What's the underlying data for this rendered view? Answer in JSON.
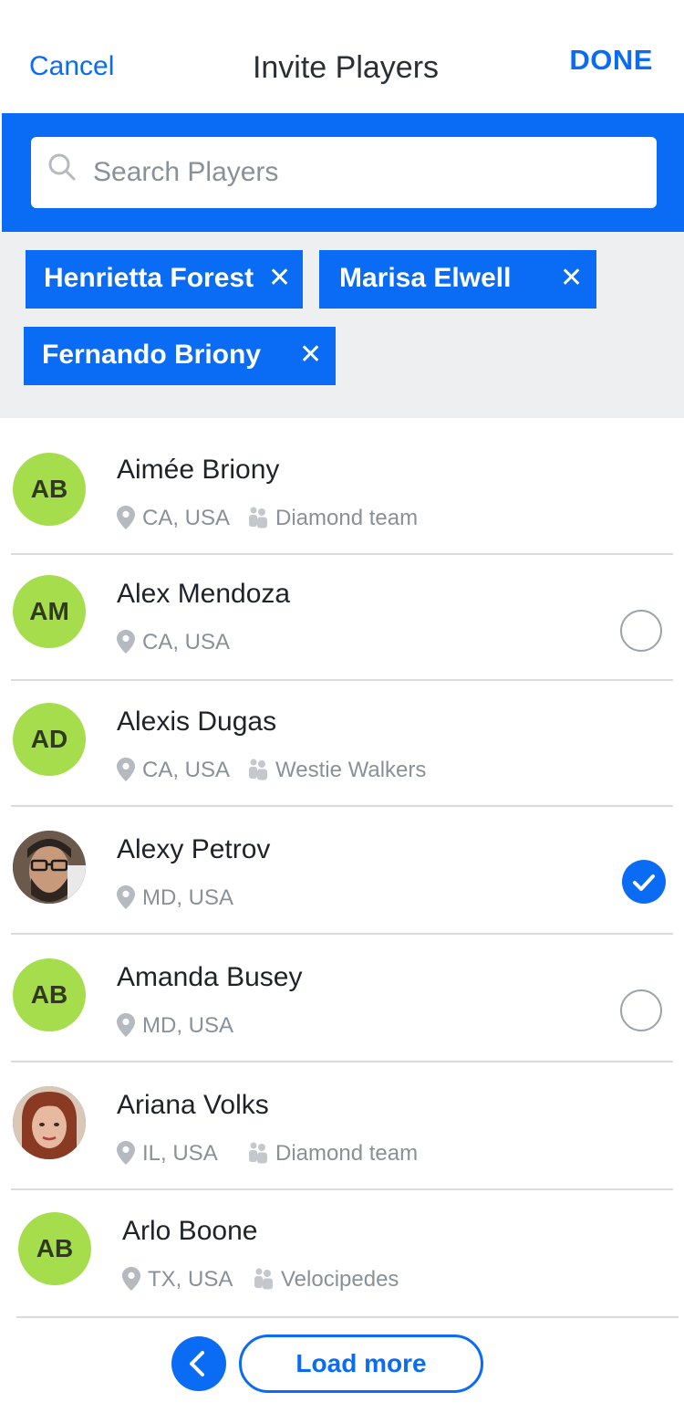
{
  "header": {
    "cancel_label": "Cancel",
    "title": "Invite Players",
    "done_label": "DONE"
  },
  "search": {
    "placeholder": "Search Players",
    "value": ""
  },
  "selected_chips": [
    {
      "label": "Henrietta Forest",
      "remove_glyph": "✕"
    },
    {
      "label": "Marisa Elwell",
      "remove_glyph": "✕"
    },
    {
      "label": "Fernando Briony",
      "remove_glyph": "✕"
    }
  ],
  "players": [
    {
      "initials": "AB",
      "name": "Aimée Briony",
      "location": "CA, USA",
      "team": "Diamond team",
      "avatar_type": "initials",
      "selection": "none"
    },
    {
      "initials": "AM",
      "name": "Alex Mendoza",
      "location": "CA, USA",
      "team": "",
      "avatar_type": "initials",
      "selection": "unchecked"
    },
    {
      "initials": "AD",
      "name": "Alexis Dugas",
      "location": "CA, USA",
      "team": "Westie Walkers",
      "avatar_type": "initials",
      "selection": "none"
    },
    {
      "initials": "",
      "name": "Alexy Petrov",
      "location": "MD, USA",
      "team": "",
      "avatar_type": "photo-man-glasses",
      "selection": "checked"
    },
    {
      "initials": "AB",
      "name": "Amanda Busey",
      "location": "MD, USA",
      "team": "",
      "avatar_type": "initials",
      "selection": "unchecked"
    },
    {
      "initials": "",
      "name": "Ariana Volks",
      "location": "IL, USA",
      "team": "Diamond team",
      "avatar_type": "photo-woman",
      "selection": "none"
    },
    {
      "initials": "AB",
      "name": "Arlo Boone",
      "location": "TX, USA",
      "team": "Velocipedes",
      "avatar_type": "initials",
      "selection": "none"
    }
  ],
  "footer": {
    "load_more_label": "Load more",
    "back_icon": "chevron-left-icon"
  },
  "colors": {
    "accent": "#0a6cf4",
    "avatar_bg": "#a6dd4d",
    "chip_area_bg": "#eeeff1",
    "muted_text": "#8a9099"
  },
  "icons": {
    "search": "search-icon",
    "location": "location-pin-icon",
    "team": "team-icon",
    "remove": "close-icon",
    "checked": "checkmark-icon"
  }
}
